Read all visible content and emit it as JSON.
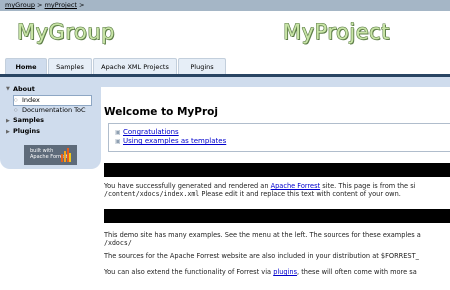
{
  "breadcrumb": {
    "item1": "myGroup",
    "sep1": " > ",
    "item2": "myProject",
    "sep2": " >"
  },
  "header": {
    "group_logo": "MyGroup",
    "project_logo": "MyProject"
  },
  "tabs": [
    {
      "label": "Home",
      "active": true
    },
    {
      "label": "Samples"
    },
    {
      "label": "Apache XML Projects"
    },
    {
      "label": "Plugins"
    }
  ],
  "menu": {
    "about": "About",
    "index": "Index",
    "doc_toc": "Documentation ToC",
    "samples": "Samples",
    "plugins": "Plugins"
  },
  "badge": {
    "line1": "built with",
    "line2": "Apache Forrest"
  },
  "page": {
    "title": "Welcome to MyProj",
    "toc": [
      "Congratulations",
      "Using examples as templates"
    ],
    "p1_a": "You have successfully generated and rendered an ",
    "p1_link": "Apache Forrest",
    "p1_b": " site. This page is from the si",
    "p1_line2_code": "/content/xdocs/index.xml",
    "p1_line2_text": " Please edit it and replace this text with content of your own.",
    "p2_line1": "This demo site has many examples. See the menu at the left. The sources for these examples a",
    "p2_line2_code": "/xdocs/",
    "p3": "The sources for the Apache Forrest website are also included in your distribution at $FORREST_",
    "p4_a": "You can also extend the functionality of Forrest via ",
    "p4_link": "plugins",
    "p4_b": ", these will often come with more sa"
  },
  "colors": {
    "accent": "#294563",
    "menu_bg": "#cfdced",
    "breadcrumb_bg": "#a5b6c6",
    "logo": "#c8e4a6",
    "link": "#0000cc"
  }
}
